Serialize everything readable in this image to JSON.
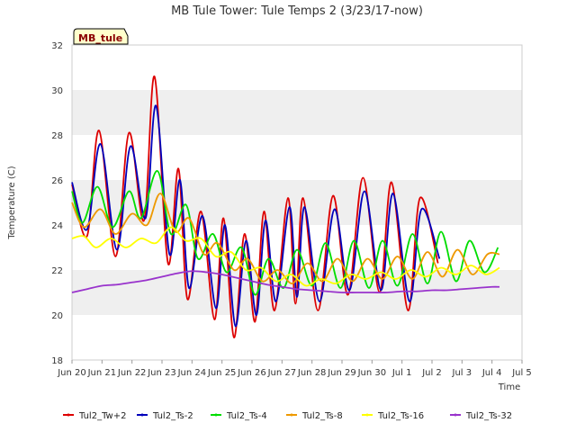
{
  "chart_data": {
    "type": "line",
    "title": "MB Tule Tower: Tule Temps 2 (3/23/17-now)",
    "xlabel": "Time",
    "ylabel": "Temperature (C)",
    "badge": "MB_tule",
    "ylim": [
      18,
      32
    ],
    "yticks": [
      18,
      20,
      22,
      24,
      26,
      28,
      30,
      32
    ],
    "xlim": [
      0,
      15
    ],
    "xticks": [
      {
        "label": "Jun 20",
        "x": 0
      },
      {
        "label": "Jun 21",
        "x": 1
      },
      {
        "label": "Jun 22",
        "x": 2
      },
      {
        "label": "Jun 23",
        "x": 3
      },
      {
        "label": "Jun 24",
        "x": 4
      },
      {
        "label": "Jun 25",
        "x": 5
      },
      {
        "label": "Jun 26",
        "x": 6
      },
      {
        "label": "Jun 27",
        "x": 7
      },
      {
        "label": "Jun 28",
        "x": 8
      },
      {
        "label": "Jun 29",
        "x": 9
      },
      {
        "label": "Jun 30",
        "x": 10
      },
      {
        "label": "Jul 1",
        "x": 11
      },
      {
        "label": "Jul 2",
        "x": 12
      },
      {
        "label": "Jul 3",
        "x": 13
      },
      {
        "label": "Jul 4",
        "x": 14
      },
      {
        "label": "Jul 5",
        "x": 15
      }
    ],
    "grid": "alternating horizontal bands",
    "legend_position": "bottom",
    "series": [
      {
        "name": "Tul2_Tw+2",
        "color": "#dd0000",
        "x": [
          0.0,
          0.5,
          0.9,
          1.45,
          1.9,
          2.4,
          2.75,
          3.2,
          3.55,
          3.85,
          4.3,
          4.75,
          5.05,
          5.4,
          5.75,
          6.1,
          6.4,
          6.75,
          7.2,
          7.45,
          7.7,
          8.2,
          8.7,
          9.2,
          9.7,
          10.25,
          10.65,
          11.2,
          11.6,
          12.2,
          12.5,
          13.1,
          13.55,
          14.0,
          14.25
        ],
        "y": [
          25.8,
          23.5,
          28.2,
          22.6,
          28.1,
          24.2,
          30.6,
          22.3,
          26.5,
          20.7,
          24.6,
          19.8,
          24.3,
          19.0,
          23.6,
          19.7,
          24.6,
          20.2,
          25.2,
          20.5,
          25.2,
          20.2,
          25.3,
          20.9,
          26.1,
          21.0,
          25.9,
          20.2,
          25.2,
          22.3,
          null,
          null,
          null,
          null,
          null
        ]
      },
      {
        "name": "Tul2_Ts-2",
        "color": "#0000bb",
        "x": [
          0.0,
          0.5,
          0.95,
          1.5,
          1.95,
          2.45,
          2.8,
          3.25,
          3.6,
          3.9,
          4.35,
          4.8,
          5.1,
          5.45,
          5.8,
          6.15,
          6.45,
          6.8,
          7.25,
          7.5,
          7.75,
          8.25,
          8.75,
          9.25,
          9.75,
          10.3,
          10.7,
          11.25,
          11.65,
          12.25
        ],
        "y": [
          25.9,
          23.8,
          27.6,
          22.9,
          27.5,
          24.3,
          29.3,
          22.7,
          26.0,
          21.2,
          24.4,
          20.3,
          24.0,
          19.5,
          23.3,
          20.0,
          24.2,
          20.6,
          24.8,
          20.8,
          24.8,
          20.6,
          24.7,
          21.1,
          25.5,
          21.1,
          25.4,
          20.6,
          24.7,
          22.5
        ]
      },
      {
        "name": "Tul2_Ts-4",
        "color": "#00dd00",
        "x": [
          0.0,
          0.35,
          0.85,
          1.35,
          1.9,
          2.3,
          2.85,
          3.3,
          3.8,
          4.2,
          4.7,
          5.15,
          5.65,
          6.1,
          6.55,
          7.05,
          7.5,
          8.0,
          8.45,
          8.95,
          9.4,
          9.9,
          10.35,
          10.85,
          11.35,
          11.85,
          12.3,
          12.8,
          13.25,
          13.75,
          14.2
        ],
        "y": [
          25.5,
          24.1,
          25.7,
          23.9,
          25.5,
          24.3,
          26.4,
          23.6,
          24.9,
          22.5,
          23.6,
          21.9,
          23.0,
          20.9,
          22.5,
          21.2,
          22.9,
          21.3,
          23.2,
          21.2,
          23.3,
          21.2,
          23.3,
          21.3,
          23.6,
          21.4,
          23.7,
          21.5,
          23.3,
          21.9,
          23.0
        ]
      },
      {
        "name": "Tul2_Ts-8",
        "color": "#ee9900",
        "x": [
          0.0,
          0.4,
          0.95,
          1.45,
          2.0,
          2.5,
          2.95,
          3.45,
          3.9,
          4.4,
          4.85,
          5.4,
          5.85,
          6.35,
          6.85,
          7.35,
          7.85,
          8.35,
          8.85,
          9.35,
          9.85,
          10.35,
          10.85,
          11.35,
          11.85,
          12.35,
          12.85,
          13.35,
          13.85,
          14.25
        ],
        "y": [
          25.0,
          23.9,
          24.7,
          23.6,
          24.5,
          24.0,
          25.4,
          23.7,
          24.3,
          22.7,
          23.2,
          22.0,
          22.5,
          21.5,
          22.0,
          21.4,
          22.3,
          21.5,
          22.5,
          21.5,
          22.5,
          21.6,
          22.6,
          21.6,
          22.8,
          21.7,
          22.9,
          21.8,
          22.7,
          22.7
        ]
      },
      {
        "name": "Tul2_Ts-16",
        "color": "#ffff00",
        "x": [
          0.0,
          0.4,
          0.8,
          1.3,
          1.8,
          2.3,
          2.8,
          3.3,
          3.8,
          4.3,
          4.8,
          5.3,
          5.8,
          6.3,
          6.8,
          7.3,
          7.8,
          8.3,
          8.8,
          9.3,
          9.8,
          10.3,
          10.8,
          11.3,
          11.8,
          12.3,
          12.8,
          13.3,
          13.8,
          14.25
        ],
        "y": [
          23.4,
          23.5,
          23.0,
          23.4,
          23.0,
          23.4,
          23.2,
          23.9,
          23.3,
          23.4,
          22.6,
          22.8,
          22.0,
          22.1,
          21.5,
          21.8,
          21.3,
          21.6,
          21.4,
          21.8,
          21.6,
          21.9,
          21.6,
          22.0,
          21.7,
          22.1,
          21.8,
          22.2,
          21.8,
          22.1
        ]
      },
      {
        "name": "Tul2_Ts-32",
        "color": "#9933cc",
        "x": [
          0.0,
          0.5,
          1.0,
          1.5,
          2.0,
          2.5,
          3.0,
          3.5,
          4.0,
          4.5,
          5.0,
          5.5,
          6.0,
          6.5,
          7.0,
          7.5,
          8.0,
          8.5,
          9.0,
          9.5,
          10.0,
          10.5,
          11.0,
          11.5,
          12.0,
          12.5,
          13.0,
          13.5,
          14.0,
          14.25
        ],
        "y": [
          21.0,
          21.15,
          21.3,
          21.35,
          21.45,
          21.55,
          21.7,
          21.85,
          21.95,
          21.9,
          21.8,
          21.65,
          21.5,
          21.35,
          21.25,
          21.15,
          21.1,
          21.05,
          21.0,
          21.0,
          21.0,
          21.0,
          21.05,
          21.05,
          21.1,
          21.1,
          21.15,
          21.2,
          21.25,
          21.25
        ]
      }
    ]
  }
}
